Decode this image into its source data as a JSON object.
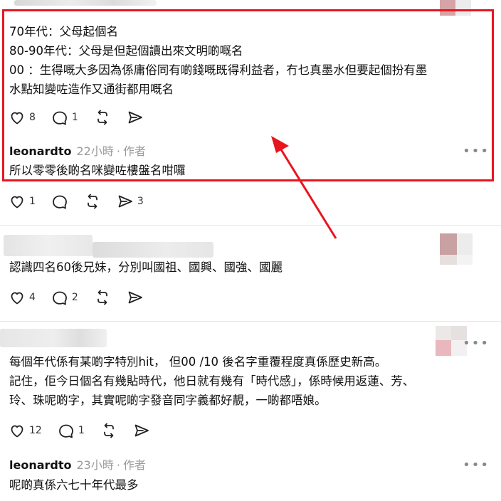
{
  "thread": {
    "post1": {
      "text": "70年代：父母起個名\n80-90年代：父母是但起個讀出來文明啲嘅名\n00 ：生得嘅大多因為係庸俗同有啲錢嘅既得利益者，冇乜真墨水但要起個扮有墨\n水點知變咗造作又通街都用嘅名",
      "likes": "8",
      "replies": "1"
    },
    "reply1": {
      "author": "leonardto",
      "time": "22小時",
      "role": "作者",
      "text": "所以零零後啲名咪變咗樓盤名咁囉",
      "likes": "1",
      "reposts": "3"
    },
    "post2": {
      "text": "認識四名60後兄妹，分別叫國祖、國興、國強、國麗",
      "likes": "4",
      "replies": "2"
    },
    "post3": {
      "text": "每個年代係有某啲字特別hit， 但00 /10 後名字重覆程度真係歷史新高。\n記住，佢今日個名有幾貼時代，他日就有幾有「時代感」，係時候用返蓮、芳、\n玲、珠呢啲字，其實呢啲字發音同字義都好靚，一啲都唔娘。",
      "likes": "12",
      "replies": "1"
    },
    "reply2": {
      "author": "leonardto",
      "time": "23小時",
      "role": "作者",
      "text": "呢啲真係六七十年代最多"
    },
    "dot": "·",
    "more_glyph": "•••"
  },
  "colors": {
    "highlight": "#e8151f",
    "arrow": "#e8151f"
  },
  "icons": [
    "heart-icon",
    "comment-icon",
    "repost-icon",
    "share-icon",
    "more-icon",
    "arrow-annotation"
  ]
}
